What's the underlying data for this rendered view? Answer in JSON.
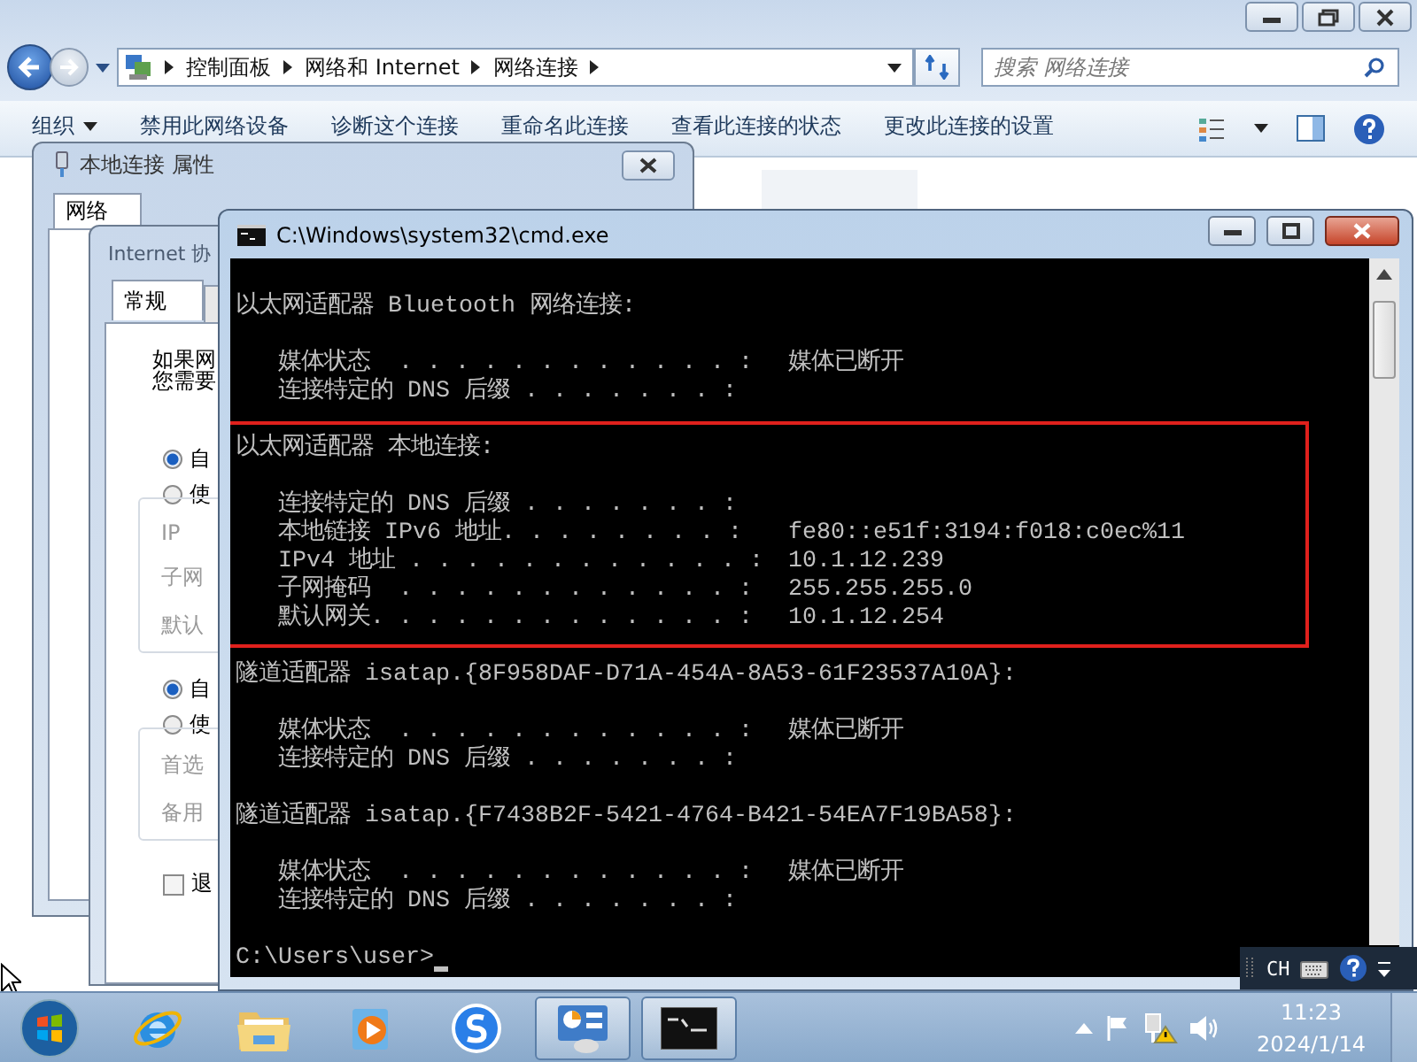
{
  "explorer": {
    "breadcrumb": [
      "控制面板",
      "网络和 Internet",
      "网络连接"
    ],
    "search": {
      "placeholder": "搜索 网络连接"
    },
    "toolbar": [
      {
        "label": "组织",
        "kind": "menu"
      },
      {
        "label": "禁用此网络设备",
        "kind": "command"
      },
      {
        "label": "诊断这个连接",
        "kind": "command"
      },
      {
        "label": "重命名此连接",
        "kind": "command"
      },
      {
        "label": "查看此连接的状态",
        "kind": "command"
      },
      {
        "label": "更改此连接的设置",
        "kind": "command"
      }
    ]
  },
  "properties_dialog": {
    "title": "本地连接 属性",
    "tabs": [
      {
        "label": "网络",
        "selected": true
      }
    ]
  },
  "ipv4_dialog": {
    "title": "Internet 协",
    "tabs": [
      {
        "label": "常规",
        "selected": true
      }
    ],
    "intro": [
      "如果网",
      "您需要"
    ],
    "groups": [
      {
        "options": [
          {
            "label": "自",
            "selected": true
          },
          {
            "label": "使",
            "selected": false
          }
        ],
        "fields": [
          {
            "label": "IP",
            "disabled": true
          },
          {
            "label": "子网",
            "disabled": true
          },
          {
            "label": "默认",
            "disabled": true
          }
        ]
      },
      {
        "options": [
          {
            "label": "自",
            "selected": true
          },
          {
            "label": "使",
            "selected": false
          }
        ],
        "fields": [
          {
            "label": "首选",
            "disabled": true
          },
          {
            "label": "备用",
            "disabled": true
          }
        ]
      }
    ],
    "checkbox": {
      "label": "退",
      "checked": false
    }
  },
  "console": {
    "title": "C:\\Windows\\system32\\cmd.exe",
    "sections": [
      {
        "highlighted": false,
        "heading": "以太网适配器 Bluetooth 网络连接:",
        "entries": [
          {
            "label": "媒体状态  . . . . . . . . . . . . :",
            "value": "媒体已断开"
          },
          {
            "label": "连接特定的 DNS 后缀 . . . . . . . :"
          }
        ]
      },
      {
        "highlighted": true,
        "heading": "以太网适配器 本地连接:",
        "entries": [
          {
            "label": "连接特定的 DNS 后缀 . . . . . . . :"
          },
          {
            "label": "本地链接 IPv6 地址. . . . . . . . :",
            "value": "fe80::e51f:3194:f018:c0ec%11"
          },
          {
            "label": "IPv4 地址 . . . . . . . . . . . . :",
            "value": "10.1.12.239"
          },
          {
            "label": "子网掩码  . . . . . . . . . . . . :",
            "value": "255.255.255.0"
          },
          {
            "label": "默认网关. . . . . . . . . . . . . :",
            "value": "10.1.12.254"
          }
        ]
      },
      {
        "highlighted": false,
        "heading": "隧道适配器 isatap.{8F958DAF-D71A-454A-8A53-61F23537A10A}:",
        "entries": [
          {
            "label": "媒体状态  . . . . . . . . . . . . :",
            "value": "媒体已断开"
          },
          {
            "label": "连接特定的 DNS 后缀 . . . . . . . :"
          }
        ]
      },
      {
        "highlighted": false,
        "heading": "隧道适配器 isatap.{F7438B2F-5421-4764-B421-54EA7F19BA58}:",
        "entries": [
          {
            "label": "媒体状态  . . . . . . . . . . . . :",
            "value": "媒体已断开"
          },
          {
            "label": "连接特定的 DNS 后缀 . . . . . . . :"
          }
        ]
      }
    ],
    "prompt": "C:\\Users\\user>"
  },
  "language_bar": {
    "language": "CH"
  },
  "taskbar": {
    "apps": [
      {
        "kind": "browser",
        "active": false
      },
      {
        "kind": "folder",
        "active": false
      },
      {
        "kind": "media",
        "active": false
      },
      {
        "kind": "s-app",
        "active": false
      },
      {
        "kind": "control-panel",
        "active": true
      },
      {
        "kind": "console",
        "active": true
      }
    ],
    "time": "11:23",
    "date": "2024/1/14"
  }
}
